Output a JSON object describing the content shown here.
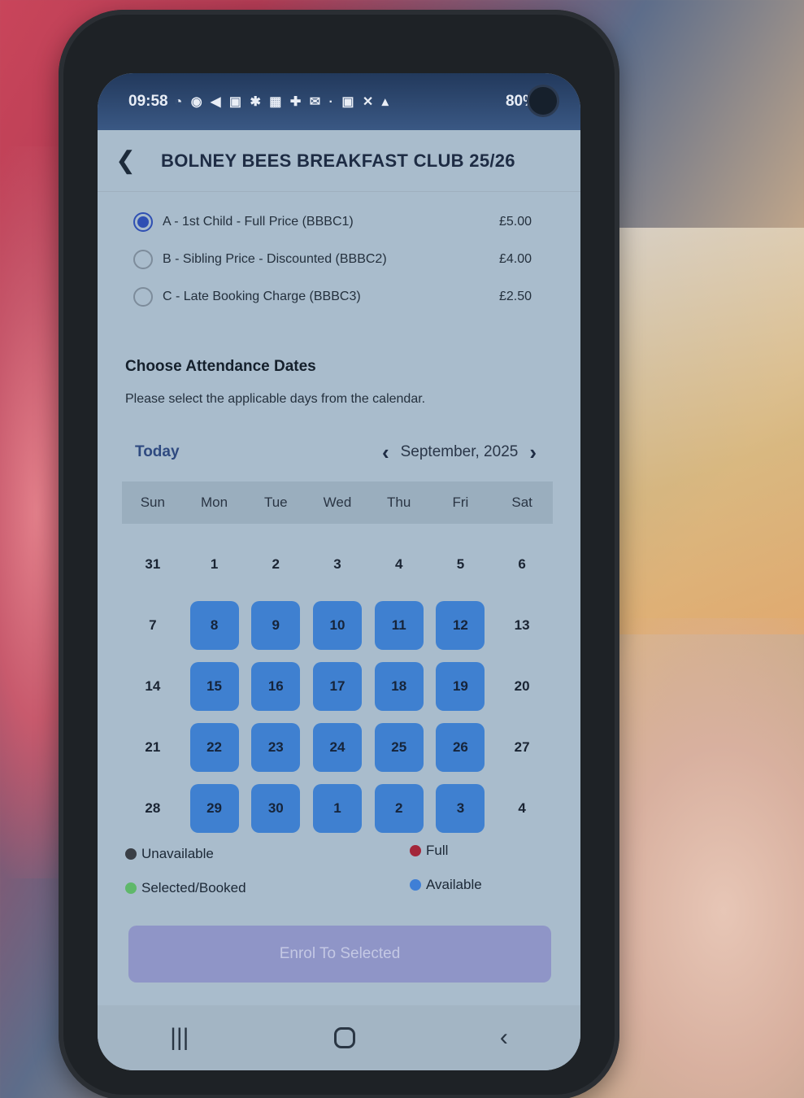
{
  "status_bar": {
    "time": "09:58",
    "icons": "◔ ◉ ◀ ▣ ✱ ▦ ✚ ✉ · ▣ ✕ ▴",
    "battery": "80%"
  },
  "header": {
    "title": "BOLNEY BEES BREAKFAST CLUB 25/26"
  },
  "price_options": [
    {
      "label": "A - 1st Child - Full Price (BBBC1)",
      "price": "£5.00",
      "selected": true
    },
    {
      "label": "B - Sibling Price - Discounted (BBBC2)",
      "price": "£4.00",
      "selected": false
    },
    {
      "label": "C - Late Booking Charge (BBBC3)",
      "price": "£2.50",
      "selected": false
    }
  ],
  "section": {
    "title": "Choose Attendance Dates",
    "description": "Please select the applicable days from the calendar."
  },
  "calendar": {
    "today_label": "Today",
    "month_label": "September, 2025",
    "weekdays": [
      "Sun",
      "Mon",
      "Tue",
      "Wed",
      "Thu",
      "Fri",
      "Sat"
    ],
    "weeks": [
      [
        {
          "d": "31",
          "s": "none"
        },
        {
          "d": "1",
          "s": "none"
        },
        {
          "d": "2",
          "s": "none"
        },
        {
          "d": "3",
          "s": "none"
        },
        {
          "d": "4",
          "s": "none"
        },
        {
          "d": "5",
          "s": "none"
        },
        {
          "d": "6",
          "s": "none"
        }
      ],
      [
        {
          "d": "7",
          "s": "none"
        },
        {
          "d": "8",
          "s": "available"
        },
        {
          "d": "9",
          "s": "available"
        },
        {
          "d": "10",
          "s": "available"
        },
        {
          "d": "11",
          "s": "available"
        },
        {
          "d": "12",
          "s": "available"
        },
        {
          "d": "13",
          "s": "none"
        }
      ],
      [
        {
          "d": "14",
          "s": "none"
        },
        {
          "d": "15",
          "s": "available"
        },
        {
          "d": "16",
          "s": "available"
        },
        {
          "d": "17",
          "s": "available"
        },
        {
          "d": "18",
          "s": "available"
        },
        {
          "d": "19",
          "s": "available"
        },
        {
          "d": "20",
          "s": "none"
        }
      ],
      [
        {
          "d": "21",
          "s": "none"
        },
        {
          "d": "22",
          "s": "available"
        },
        {
          "d": "23",
          "s": "available"
        },
        {
          "d": "24",
          "s": "available"
        },
        {
          "d": "25",
          "s": "available"
        },
        {
          "d": "26",
          "s": "available"
        },
        {
          "d": "27",
          "s": "none"
        }
      ],
      [
        {
          "d": "28",
          "s": "none"
        },
        {
          "d": "29",
          "s": "available"
        },
        {
          "d": "30",
          "s": "available"
        },
        {
          "d": "1",
          "s": "available"
        },
        {
          "d": "2",
          "s": "available"
        },
        {
          "d": "3",
          "s": "available"
        },
        {
          "d": "4",
          "s": "none"
        }
      ]
    ]
  },
  "legend": {
    "unavailable": {
      "label": "Unavailable",
      "color": "#3a3f46"
    },
    "full": {
      "label": "Full",
      "color": "#a3263a"
    },
    "selected": {
      "label": "Selected/Booked",
      "color": "#5fb86a"
    },
    "available": {
      "label": "Available",
      "color": "#3f7fd6"
    }
  },
  "enrol_button": {
    "label": "Enrol To Selected"
  },
  "nav_bar": {
    "recents": "|||",
    "back": "‹"
  },
  "colors": {
    "accent": "#2f4fb3",
    "available": "#3f80d0",
    "button": "#8f95c7"
  }
}
